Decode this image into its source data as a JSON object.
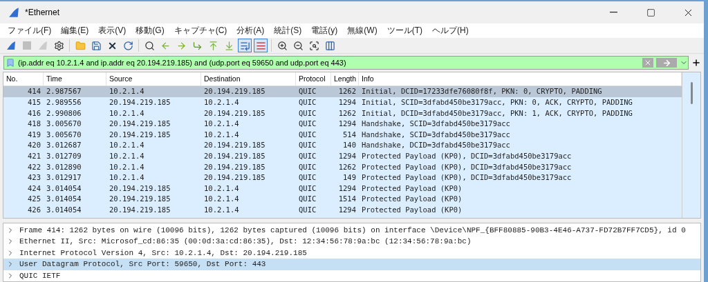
{
  "window": {
    "title": "*Ethernet"
  },
  "menu": [
    "ファイル(F)",
    "編集(E)",
    "表示(V)",
    "移動(G)",
    "キャプチャ(C)",
    "分析(A)",
    "統計(S)",
    "電話(y)",
    "無線(W)",
    "ツール(T)",
    "ヘルプ(H)"
  ],
  "toolbar": [
    {
      "kind": "start",
      "disabled": false,
      "selected": false
    },
    {
      "kind": "stop",
      "disabled": true,
      "selected": false
    },
    {
      "kind": "restart",
      "disabled": true,
      "selected": false
    },
    {
      "kind": "options",
      "disabled": false,
      "selected": false
    },
    {
      "kind": "sep"
    },
    {
      "kind": "open",
      "disabled": false,
      "selected": false
    },
    {
      "kind": "save",
      "disabled": false,
      "selected": false
    },
    {
      "kind": "close",
      "disabled": false,
      "selected": false
    },
    {
      "kind": "reload",
      "disabled": false,
      "selected": false
    },
    {
      "kind": "sep"
    },
    {
      "kind": "find",
      "disabled": false,
      "selected": false
    },
    {
      "kind": "back",
      "disabled": false,
      "selected": false
    },
    {
      "kind": "forward",
      "disabled": false,
      "selected": false
    },
    {
      "kind": "goto",
      "disabled": false,
      "selected": false
    },
    {
      "kind": "first",
      "disabled": false,
      "selected": false
    },
    {
      "kind": "last",
      "disabled": false,
      "selected": false
    },
    {
      "kind": "autoscroll",
      "disabled": false,
      "selected": true
    },
    {
      "kind": "colorize",
      "disabled": false,
      "selected": true
    },
    {
      "kind": "sep"
    },
    {
      "kind": "zoomin",
      "disabled": false,
      "selected": false
    },
    {
      "kind": "zoomout",
      "disabled": false,
      "selected": false
    },
    {
      "kind": "zoomreset",
      "disabled": false,
      "selected": false
    },
    {
      "kind": "resize",
      "disabled": false,
      "selected": false
    }
  ],
  "filter": {
    "value": "(ip.addr eq 10.2.1.4 and ip.addr eq 20.194.219.185) and (udp.port eq 59650 and udp.port eq 443)"
  },
  "table": {
    "columns": [
      "No.",
      "Time",
      "Source",
      "Destination",
      "Protocol",
      "Length",
      "Info"
    ],
    "rows": [
      {
        "selected": true,
        "cells": [
          "414",
          "2.987567",
          "10.2.1.4",
          "20.194.219.185",
          "QUIC",
          "1262",
          "Initial, DCID=17233dfe76080f8f, PKN: 0, CRYPTO, PADDING"
        ]
      },
      {
        "selected": false,
        "cells": [
          "415",
          "2.989556",
          "20.194.219.185",
          "10.2.1.4",
          "QUIC",
          "1294",
          "Initial, SCID=3dfabd450be3179acc, PKN: 0, ACK, CRYPTO, PADDING"
        ]
      },
      {
        "selected": false,
        "cells": [
          "416",
          "2.990806",
          "10.2.1.4",
          "20.194.219.185",
          "QUIC",
          "1262",
          "Initial, DCID=3dfabd450be3179acc, PKN: 1, ACK, CRYPTO, PADDING"
        ]
      },
      {
        "selected": false,
        "cells": [
          "418",
          "3.005670",
          "20.194.219.185",
          "10.2.1.4",
          "QUIC",
          "1294",
          "Handshake, SCID=3dfabd450be3179acc"
        ]
      },
      {
        "selected": false,
        "cells": [
          "419",
          "3.005670",
          "20.194.219.185",
          "10.2.1.4",
          "QUIC",
          "514",
          "Handshake, SCID=3dfabd450be3179acc"
        ]
      },
      {
        "selected": false,
        "cells": [
          "420",
          "3.012687",
          "10.2.1.4",
          "20.194.219.185",
          "QUIC",
          "140",
          "Handshake, DCID=3dfabd450be3179acc"
        ]
      },
      {
        "selected": false,
        "cells": [
          "421",
          "3.012709",
          "10.2.1.4",
          "20.194.219.185",
          "QUIC",
          "1294",
          "Protected Payload (KP0), DCID=3dfabd450be3179acc"
        ]
      },
      {
        "selected": false,
        "cells": [
          "422",
          "3.012890",
          "10.2.1.4",
          "20.194.219.185",
          "QUIC",
          "1262",
          "Protected Payload (KP0), DCID=3dfabd450be3179acc"
        ]
      },
      {
        "selected": false,
        "cells": [
          "423",
          "3.012917",
          "10.2.1.4",
          "20.194.219.185",
          "QUIC",
          "149",
          "Protected Payload (KP0), DCID=3dfabd450be3179acc"
        ]
      },
      {
        "selected": false,
        "cells": [
          "424",
          "3.014054",
          "20.194.219.185",
          "10.2.1.4",
          "QUIC",
          "1294",
          "Protected Payload (KP0)"
        ]
      },
      {
        "selected": false,
        "cells": [
          "425",
          "3.014054",
          "20.194.219.185",
          "10.2.1.4",
          "QUIC",
          "1514",
          "Protected Payload (KP0)"
        ]
      },
      {
        "selected": false,
        "cells": [
          "426",
          "3.014054",
          "20.194.219.185",
          "10.2.1.4",
          "QUIC",
          "1294",
          "Protected Payload (KP0)"
        ]
      }
    ]
  },
  "details": [
    {
      "text": "Frame 414: 1262 bytes on wire (10096 bits), 1262 bytes captured (10096 bits) on interface \\Device\\NPF_{BFF80885-90B3-4E46-A737-FD72B7FF7CD5}, id 0",
      "expanded": false,
      "selected": false
    },
    {
      "text": "Ethernet II, Src: Microsof_cd:86:35 (00:0d:3a:cd:86:35), Dst: 12:34:56:78:9a:bc (12:34:56:78:9a:bc)",
      "expanded": false,
      "selected": false
    },
    {
      "text": "Internet Protocol Version 4, Src: 10.2.1.4, Dst: 20.194.219.185",
      "expanded": false,
      "selected": false
    },
    {
      "text": "User Datagram Protocol, Src Port: 59650, Dst Port: 443",
      "expanded": false,
      "selected": true
    },
    {
      "text": "QUIC IETF",
      "expanded": false,
      "selected": false
    }
  ]
}
